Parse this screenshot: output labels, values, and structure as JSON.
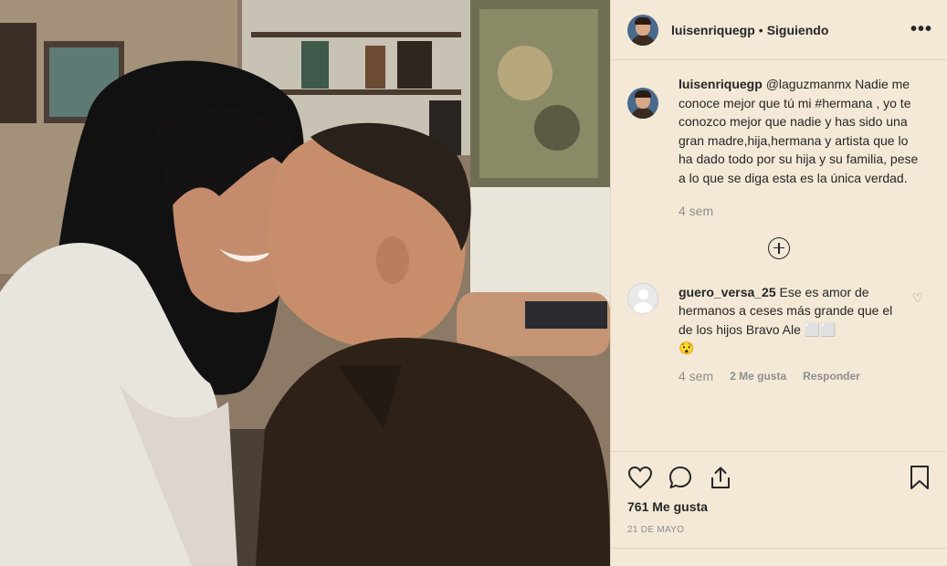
{
  "header": {
    "username": "luisenriquegp",
    "separator": "•",
    "follow_status": "Siguiendo",
    "more_label": "•••"
  },
  "caption": {
    "username": "luisenriquegp",
    "mention": "@laguzmanmx",
    "text_1": " Nadie me conoce mejor que tú mi ",
    "hashtag": "#hermana",
    "text_2": " , yo te conozco mejor que nadie y has sido una gran madre,hija,hermana y artista que lo ha dado todo por su hija y su familia, pese a lo que se diga esta es la única verdad.",
    "time": "4 sem"
  },
  "load_more": "",
  "comment": {
    "username": "guero_versa_25",
    "text": " Ese es amor de hermanos a ceses más grande que el de los hijos Bravo Ale ⬜⬜",
    "emoji": "😯",
    "time": "4 sem",
    "likes": "2 Me gusta",
    "reply": "Responder"
  },
  "post": {
    "likes": "761 Me gusta",
    "date": "21 DE MAYO"
  },
  "colors": {
    "panel_bg": "#f3e9d6",
    "text": "#262626",
    "muted": "#8e8e8e"
  },
  "icons": [
    "heart-icon",
    "comment-icon",
    "share-icon",
    "bookmark-icon",
    "add-circle-icon",
    "more-icon"
  ]
}
